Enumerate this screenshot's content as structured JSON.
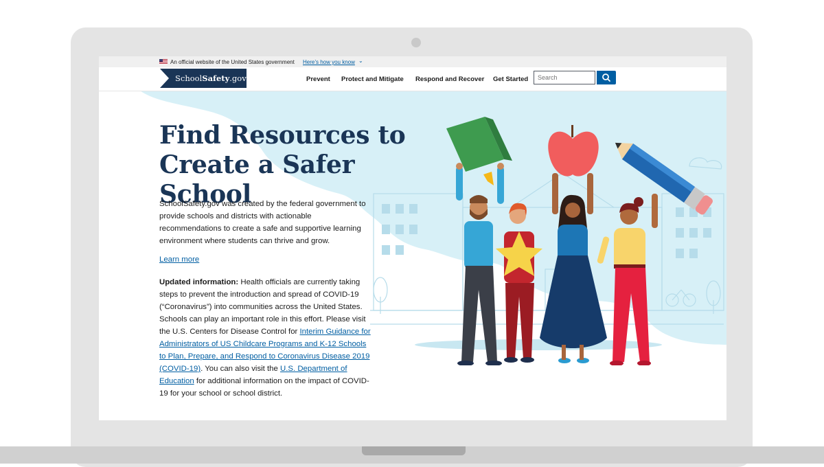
{
  "banner": {
    "official_text": "An official website of the United States government",
    "how_link": "Here’s how you know"
  },
  "header": {
    "logo_prefix": "School",
    "logo_bold": "Safety",
    "logo_suffix": ".gov",
    "nav": [
      "Prevent",
      "Protect and Mitigate",
      "Respond and Recover",
      "Get Started"
    ],
    "search_placeholder": "Search"
  },
  "hero": {
    "title_line1": "Find Resources to",
    "title_line2": "Create a Safer School",
    "intro": "SchoolSafety.gov was created by the federal government to provide schools and districts with actionable recommendations to create a safe and supportive learning environment where students can thrive and grow.",
    "learn_more": "Learn more",
    "update_label": "Updated information:",
    "update_text1": " Health officials are currently taking steps to prevent the introduction and spread of COVID-19 (“Coronavirus”) into communities across the United States. Schools can play an important role in this effort. Please visit the U.S. Centers for Disease Control for ",
    "update_link1": "Interim Guidance for Administrators of US Childcare Programs and K-12 Schools to Plan, Prepare, and Respond to Coronavirus Disease 2019 (COVID-19)",
    "update_text2": ". You can also visit the ",
    "update_link2": "U.S. Department of Education",
    "update_text3": " for additional information on the impact of COVID-19 for your school or school district."
  },
  "colors": {
    "brand_navy": "#1a3556",
    "link_blue": "#005ea2",
    "hero_light_blue": "#d7f0f7"
  },
  "icons": [
    "us-flag-icon",
    "chevron-down-icon",
    "search-icon",
    "apple-icon",
    "book-icon",
    "pencil-icon",
    "star-icon"
  ]
}
